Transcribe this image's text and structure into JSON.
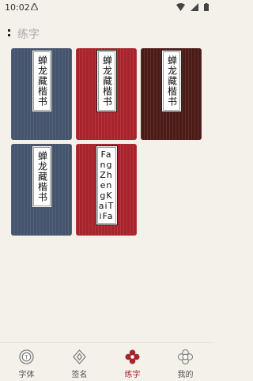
{
  "status_bar": {
    "time": "10:02"
  },
  "header": {
    "title": "练字"
  },
  "cards": [
    {
      "label": "楷书",
      "name": "蝉龙藏楷书",
      "color": "#44546c"
    },
    {
      "label": "楷书",
      "name": "蝉龙藏楷书",
      "color": "#a9232c"
    },
    {
      "label": "楷书",
      "name": "蝉龙藏楷书",
      "color": "#4c1b18"
    },
    {
      "label": "楷书",
      "name": "蝉龙藏楷书",
      "color": "#44546c"
    },
    {
      "label": "FangZhengKaiTiFa",
      "name": "FangZhengKaiTiFa",
      "color": "#a9232c"
    }
  ],
  "tabs": [
    {
      "label": "字体",
      "icon": "font-icon",
      "active": false
    },
    {
      "label": "签名",
      "icon": "signature-icon",
      "active": false
    },
    {
      "label": "练字",
      "icon": "practice-icon",
      "active": true
    },
    {
      "label": "我的",
      "icon": "profile-icon",
      "active": false
    }
  ],
  "colors": {
    "accent": "#a9232c",
    "background": "#f4f1ea",
    "blue_card": "#44546c",
    "red_card": "#a9232c",
    "brown_card": "#4c1b18"
  }
}
